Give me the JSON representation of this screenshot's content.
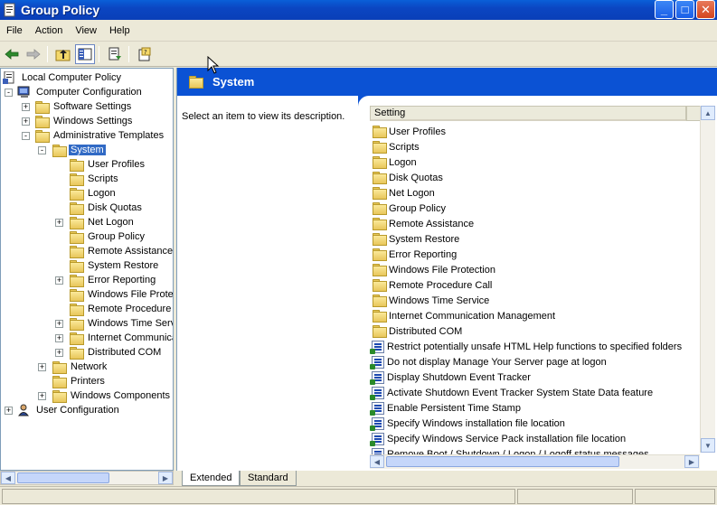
{
  "window": {
    "title": "Group Policy"
  },
  "menu": [
    "File",
    "Action",
    "View",
    "Help"
  ],
  "toolbar": [
    "back-icon",
    "forward-icon",
    "up-folder-icon",
    "show-hide-tree-icon",
    "export-list-icon",
    "help-icon"
  ],
  "tree": [
    {
      "label": "Local Computer Policy",
      "icon": "policy-icon",
      "level": 0,
      "expander": ""
    },
    {
      "label": "Computer Configuration",
      "icon": "computer-icon",
      "level": 1,
      "expander": "-"
    },
    {
      "label": "Software Settings",
      "icon": "folder",
      "level": 2,
      "expander": "+"
    },
    {
      "label": "Windows Settings",
      "icon": "folder",
      "level": 2,
      "expander": "+"
    },
    {
      "label": "Administrative Templates",
      "icon": "folder",
      "level": 2,
      "expander": "-"
    },
    {
      "label": "System",
      "icon": "folder-open",
      "level": 3,
      "expander": "-",
      "selected": true
    },
    {
      "label": "User Profiles",
      "icon": "folder",
      "level": 4,
      "expander": ""
    },
    {
      "label": "Scripts",
      "icon": "folder",
      "level": 4,
      "expander": ""
    },
    {
      "label": "Logon",
      "icon": "folder",
      "level": 4,
      "expander": ""
    },
    {
      "label": "Disk Quotas",
      "icon": "folder",
      "level": 4,
      "expander": ""
    },
    {
      "label": "Net Logon",
      "icon": "folder",
      "level": 4,
      "expander": "+"
    },
    {
      "label": "Group Policy",
      "icon": "folder",
      "level": 4,
      "expander": ""
    },
    {
      "label": "Remote Assistance",
      "icon": "folder",
      "level": 4,
      "expander": ""
    },
    {
      "label": "System Restore",
      "icon": "folder",
      "level": 4,
      "expander": ""
    },
    {
      "label": "Error Reporting",
      "icon": "folder",
      "level": 4,
      "expander": "+"
    },
    {
      "label": "Windows File Protec",
      "icon": "folder",
      "level": 4,
      "expander": ""
    },
    {
      "label": "Remote Procedure C",
      "icon": "folder",
      "level": 4,
      "expander": ""
    },
    {
      "label": "Windows Time Serv",
      "icon": "folder",
      "level": 4,
      "expander": "+"
    },
    {
      "label": "Internet Communica",
      "icon": "folder",
      "level": 4,
      "expander": "+"
    },
    {
      "label": "Distributed COM",
      "icon": "folder",
      "level": 4,
      "expander": "+"
    },
    {
      "label": "Network",
      "icon": "folder",
      "level": 3,
      "expander": "+"
    },
    {
      "label": "Printers",
      "icon": "folder",
      "level": 3,
      "expander": ""
    },
    {
      "label": "Windows Components",
      "icon": "folder",
      "level": 3,
      "expander": "+"
    },
    {
      "label": "User Configuration",
      "icon": "user-icon",
      "level": 1,
      "expander": "+"
    }
  ],
  "detail": {
    "header": "System",
    "description": "Select an item to view its description.",
    "column": "Setting",
    "rows": [
      {
        "label": "User Profiles",
        "type": "folder"
      },
      {
        "label": "Scripts",
        "type": "folder"
      },
      {
        "label": "Logon",
        "type": "folder"
      },
      {
        "label": "Disk Quotas",
        "type": "folder"
      },
      {
        "label": "Net Logon",
        "type": "folder"
      },
      {
        "label": "Group Policy",
        "type": "folder"
      },
      {
        "label": "Remote Assistance",
        "type": "folder"
      },
      {
        "label": "System Restore",
        "type": "folder"
      },
      {
        "label": "Error Reporting",
        "type": "folder"
      },
      {
        "label": "Windows File Protection",
        "type": "folder"
      },
      {
        "label": "Remote Procedure Call",
        "type": "folder"
      },
      {
        "label": "Windows Time Service",
        "type": "folder"
      },
      {
        "label": "Internet Communication Management",
        "type": "folder"
      },
      {
        "label": "Distributed COM",
        "type": "folder"
      },
      {
        "label": "Restrict potentially unsafe HTML Help functions to specified folders",
        "type": "setting"
      },
      {
        "label": "Do not display Manage Your Server page at logon",
        "type": "setting"
      },
      {
        "label": "Display Shutdown Event Tracker",
        "type": "setting"
      },
      {
        "label": "Activate Shutdown Event Tracker System State Data feature",
        "type": "setting"
      },
      {
        "label": "Enable Persistent Time Stamp",
        "type": "setting"
      },
      {
        "label": "Specify Windows installation file location",
        "type": "setting"
      },
      {
        "label": "Specify Windows Service Pack installation file location",
        "type": "setting"
      },
      {
        "label": "Remove Boot / Shutdown / Logon / Logoff status messages",
        "type": "setting"
      }
    ]
  },
  "tabs": [
    {
      "label": "Extended",
      "active": true
    },
    {
      "label": "Standard",
      "active": false
    }
  ],
  "colors": {
    "titlebar": "#0b46c2",
    "header_band": "#0b52d4",
    "selection": "#316ac5"
  }
}
